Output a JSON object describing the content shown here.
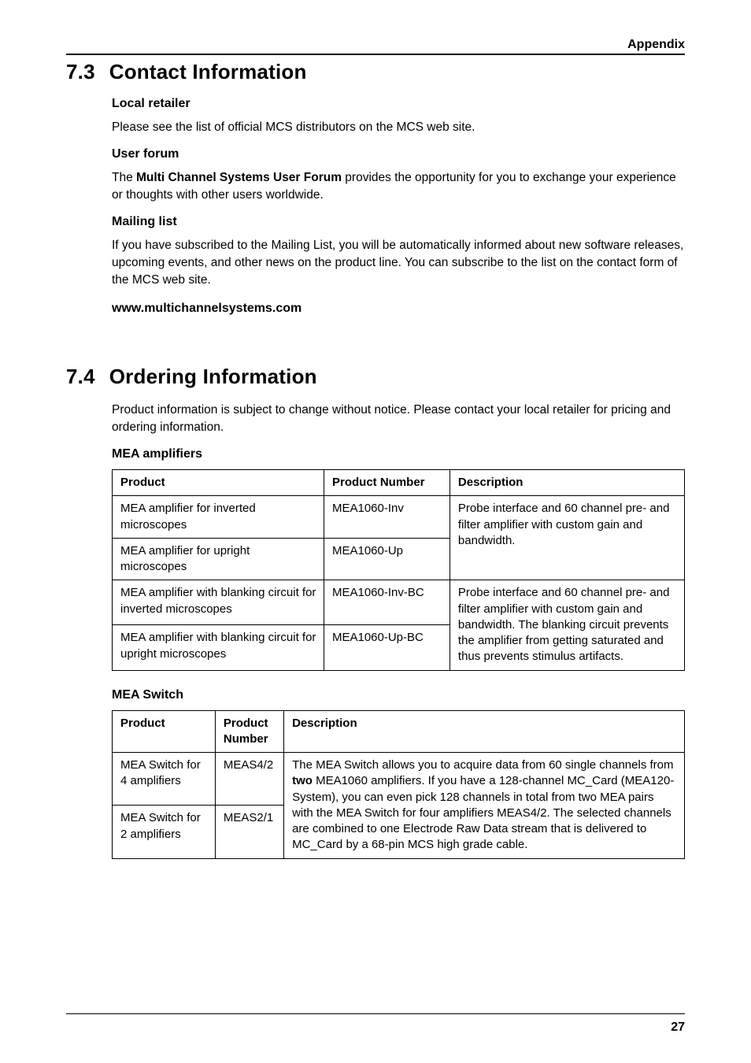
{
  "runningHead": "Appendix",
  "section73": {
    "number": "7.3",
    "title": "Contact Information",
    "localRetailer": {
      "heading": "Local retailer",
      "text": "Please see the list of official MCS distributors on the MCS web site."
    },
    "userForum": {
      "heading": "User forum",
      "lead": "The ",
      "bold": "Multi Channel Systems User Forum",
      "rest": " provides the opportunity for you to exchange your experience or thoughts with other users worldwide."
    },
    "mailingList": {
      "heading": "Mailing list",
      "text": "If you have subscribed to the Mailing List, you will be automatically informed about new software releases, upcoming events, and other news on the product line. You can subscribe to the list on the contact form of the MCS web site."
    },
    "www": "www.multichannelsystems.com"
  },
  "section74": {
    "number": "7.4",
    "title": "Ordering Information",
    "intro": "Product information is subject to change without notice. Please contact your local retailer for pricing and ordering information.",
    "meaAmplifiers": {
      "heading": "MEA amplifiers",
      "headers": {
        "c1": "Product",
        "c2": "Product Number",
        "c3": "Description"
      },
      "row1": {
        "product": "MEA amplifier for inverted microscopes",
        "pn": "MEA1060-Inv"
      },
      "row2": {
        "product": "MEA amplifier for upright microscopes",
        "pn": "MEA1060-Up"
      },
      "desc12": "Probe interface and 60 channel pre- and filter amplifier with custom gain and bandwidth.",
      "row3": {
        "product": "MEA amplifier with blanking circuit for inverted microscopes",
        "pn": "MEA1060-Inv-BC"
      },
      "row4": {
        "product": "MEA amplifier with blanking circuit for upright microscopes",
        "pn": "MEA1060-Up-BC"
      },
      "desc34": "Probe interface and 60 channel pre- and filter amplifier with custom gain and bandwidth. The blanking circuit prevents the amplifier from getting saturated and thus prevents stimulus artifacts."
    },
    "meaSwitch": {
      "heading": "MEA Switch",
      "headers": {
        "c1": "Product",
        "c2": "Product Number",
        "c3": "Description"
      },
      "row1": {
        "product": "MEA Switch for 4 amplifiers",
        "pn": "MEAS4/2"
      },
      "row2": {
        "product": "MEA Switch for 2 amplifiers",
        "pn": "MEAS2/1"
      },
      "descLead": "The MEA Switch allows you to acquire data from 60 single channels from ",
      "descBold": "two",
      "descRest": " MEA1060 amplifiers. If you have a 128-channel MC_Card (MEA120-System), you can even pick 128 channels in total from two MEA pairs with the MEA Switch for four amplifiers MEAS4/2. The selected channels are combined to one Electrode Raw Data stream that is delivered to MC_Card by a 68-pin MCS high grade cable."
    }
  },
  "pageNumber": "27"
}
